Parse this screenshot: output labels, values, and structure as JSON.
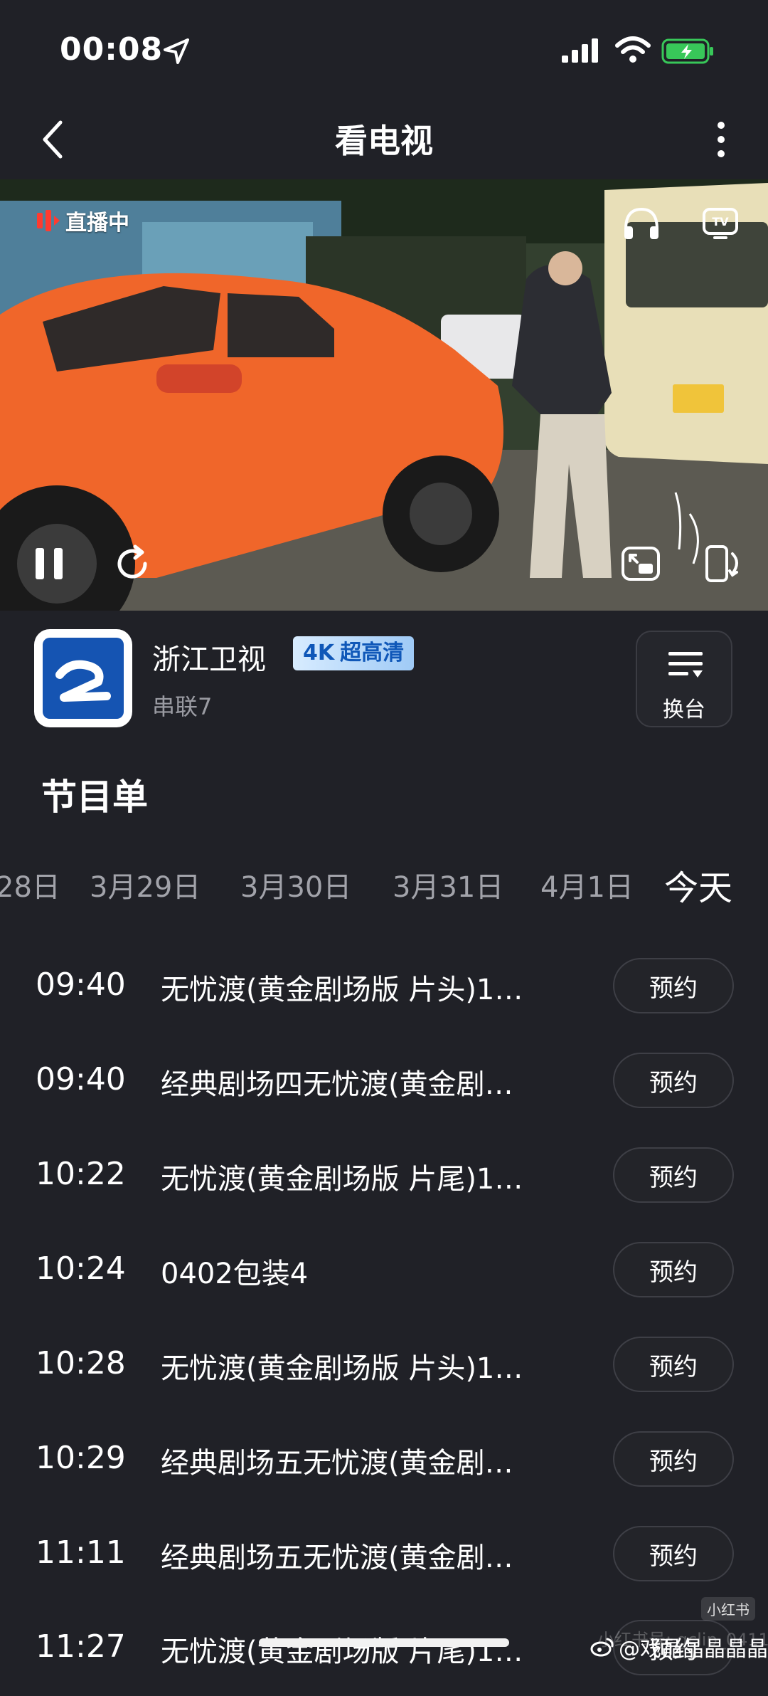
{
  "status_bar": {
    "time": "00:08"
  },
  "nav": {
    "title": "看电视"
  },
  "player": {
    "live_label": "直播中",
    "state": "playing"
  },
  "channel": {
    "name": "浙江卫视",
    "quality_4k": "4K",
    "quality_text": "超高清",
    "now_playing": "串联7",
    "switch_label": "换台"
  },
  "schedule": {
    "title": "节目单",
    "dates": [
      "28日",
      "3月29日",
      "3月30日",
      "3月31日",
      "4月1日",
      "今天"
    ],
    "active_date": "今天",
    "programs": [
      {
        "time": "09:40",
        "title": "无忧渡(黄金剧场版 片头)1…",
        "action": "预约"
      },
      {
        "time": "09:40",
        "title": "经典剧场四无忧渡(黄金剧…",
        "action": "预约"
      },
      {
        "time": "10:22",
        "title": "无忧渡(黄金剧场版 片尾)1…",
        "action": "预约"
      },
      {
        "time": "10:24",
        "title": "0402包装4",
        "action": "预约"
      },
      {
        "time": "10:28",
        "title": "无忧渡(黄金剧场版 片头)1…",
        "action": "预约"
      },
      {
        "time": "10:29",
        "title": "经典剧场五无忧渡(黄金剧…",
        "action": "预约"
      },
      {
        "time": "11:11",
        "title": "经典剧场五无忧渡(黄金剧…",
        "action": "预约"
      },
      {
        "time": "11:27",
        "title": "无忧渡(黄金剧场版 片尾)1…",
        "action": "预约"
      }
    ]
  },
  "watermark": {
    "badge": "小红书",
    "id": "小红书号: gclip_0411",
    "weibo": "@戏晶晶晶晶晶"
  },
  "colors": {
    "background": "#202127",
    "muted_text": "#9a9ba2",
    "accent_blue": "#0f57b8",
    "car_orange": "#f0662a"
  }
}
